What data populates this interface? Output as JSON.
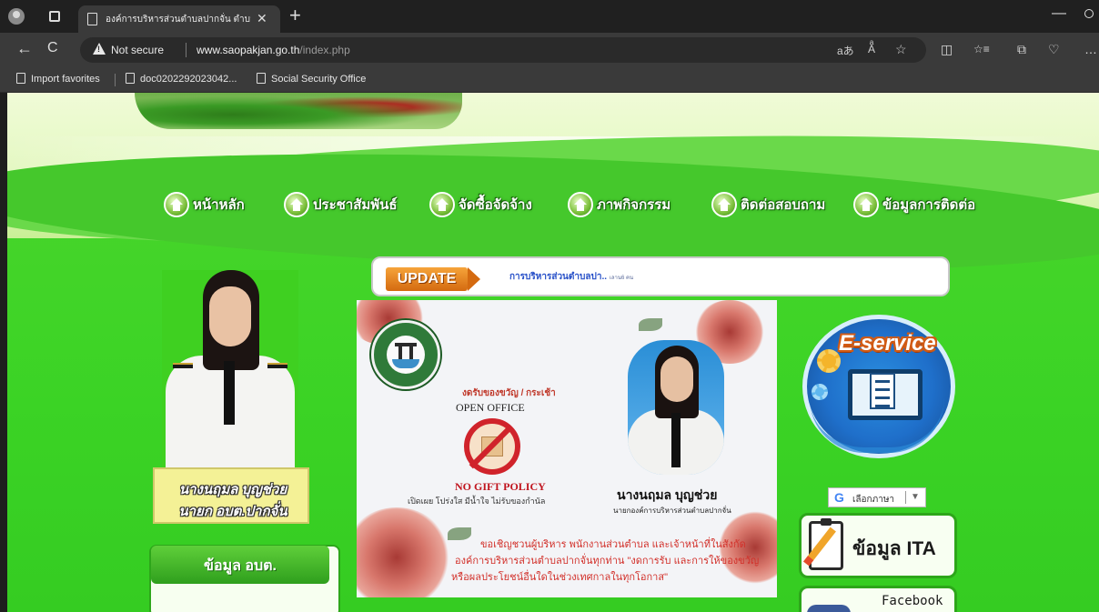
{
  "browser": {
    "tab_title": "องค์การบริหารส่วนตำบลปากจั่น ตำบลปากจั่น",
    "tab_close": "✕",
    "new_tab": "+",
    "minimize": "—",
    "back": "←",
    "reload": "C",
    "security_label": "Not secure",
    "url_host": "www.saopakjan.go.th",
    "url_path": "/index.php",
    "addr_icons": [
      "aあ",
      "A͏ͣ",
      "☆"
    ],
    "toolbar_icons": [
      "◫",
      "☆≡",
      "⧉",
      "♡",
      "…"
    ]
  },
  "favorites": {
    "import_label": "Import favorites",
    "items": [
      "doc0202292023042...",
      "Social Security Office"
    ]
  },
  "site": {
    "menu": [
      "หน้าหลัก",
      "ประชาสัมพันธ์",
      "จัดซื้อจัดจ้าง",
      "ภาพกิจกรรม",
      "ติดต่อสอบถาม",
      "ข้อมูลการติดต่อ"
    ],
    "mayor": {
      "name_line1": "นางนฤมล บุญช่วย",
      "name_line2": "นายก อบต.ปากจั่น"
    },
    "info_box_title": "ข้อมูล อบต.",
    "update": {
      "badge": "UPDATE",
      "marquee_text": "การบริหารส่วนตำบลปา..",
      "marquee_sub": "เลาน6 คน"
    },
    "poster": {
      "red_note": "งดรับของขวัญ / กระเช้า",
      "open_office": "OPEN OFFICE",
      "no_gift": "NO GIFT POLICY",
      "small_text": "เปิดเผย โปร่งใส มีน้ำใจ ไม่รับของกำนัล",
      "person_name": "นางนฤมล บุญช่วย",
      "person_title": "นายกองค์การบริหารส่วนตำบลปากจั่น",
      "invite_line1": "ขอเชิญชวนผู้บริหาร พนักงานส่วนตำบล และเจ้าหน้าที่ในสังกัด",
      "invite_line2": "องค์การบริหารส่วนตำบลปากจั่นทุกท่าน \"งดการรับ และการให้ของขวัญ",
      "invite_line3": "หรือผลประโยชน์อื่นใดในช่วงเทศกาลในทุกโอกาส\""
    },
    "eservice_label": "E-service",
    "translate": {
      "g": "G",
      "label": "เลือกภาษา",
      "arrow": "▼"
    },
    "ita_label": "ข้อมูล ITA",
    "facebook_label": "Facebook"
  }
}
